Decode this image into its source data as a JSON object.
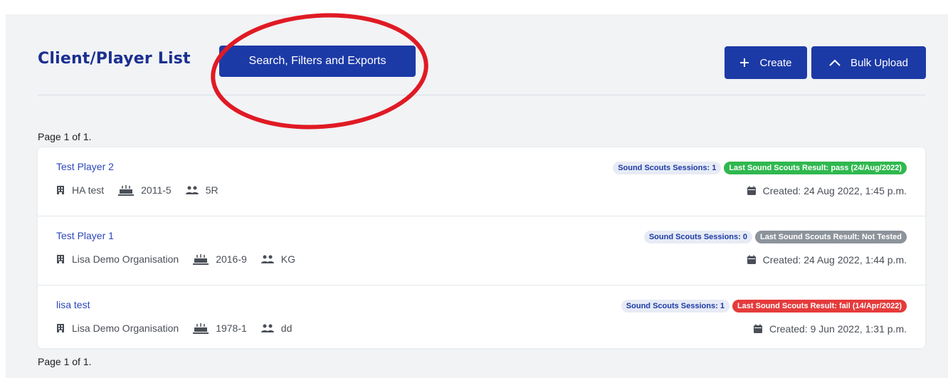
{
  "header": {
    "title": "Client/Player List",
    "search_button": "Search, Filters and Exports",
    "create_button": "Create",
    "bulk_upload_button": "Bulk Upload"
  },
  "pagination": {
    "top": "Page 1 of 1.",
    "bottom": "Page 1 of 1."
  },
  "icons": {
    "plus": "plus-icon",
    "chevron": "chevron-up-icon",
    "organisation": "building-icon",
    "cohort": "cake-icon",
    "group": "group-icon",
    "calendar": "calendar-icon"
  },
  "colors": {
    "brand": "#1c3aa6",
    "title": "#1b2f8f",
    "pass": "#2fb84f",
    "not_tested": "#8c939b",
    "fail": "#e53b3b",
    "annotation": "#e01a24"
  },
  "players": [
    {
      "name": "Test Player 2",
      "organisation": "HA test",
      "cohort": "2011-5",
      "group": "5R",
      "sessions": "Sound Scouts Sessions: 1",
      "result": "Last Sound Scouts Result: pass (24/Aug/2022)",
      "result_color": "#2fb84f",
      "created": "Created: 24 Aug 2022, 1:45 p.m."
    },
    {
      "name": "Test Player 1",
      "organisation": "Lisa Demo Organisation",
      "cohort": "2016-9",
      "group": "KG",
      "sessions": "Sound Scouts Sessions: 0",
      "result": "Last Sound Scouts Result: Not Tested",
      "result_color": "#8c939b",
      "created": "Created: 24 Aug 2022, 1:44 p.m."
    },
    {
      "name": "lisa test",
      "organisation": "Lisa Demo Organisation",
      "cohort": "1978-1",
      "group": "dd",
      "sessions": "Sound Scouts Sessions: 1",
      "result": "Last Sound Scouts Result: fail (14/Apr/2022)",
      "result_color": "#e53b3b",
      "created": "Created: 9 Jun 2022, 1:31 p.m."
    }
  ]
}
